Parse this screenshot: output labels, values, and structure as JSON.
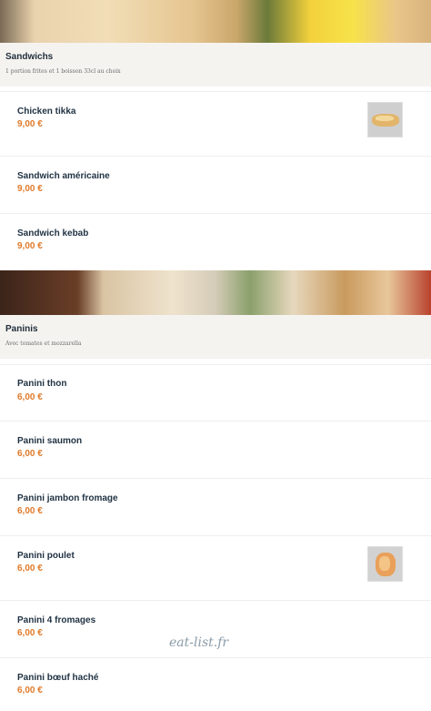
{
  "colors": {
    "accent_price": "#e07a2a",
    "header_bg": "#f5f3f0",
    "title": "#1f3142"
  },
  "categories": [
    {
      "title": "Sandwichs",
      "subtitle": "1 portion frites et 1 boisson 33cl au choix",
      "items": [
        {
          "name": "Chicken tikka",
          "price": "9,00 €",
          "image": "sandwich-photo"
        },
        {
          "name": "Sandwich américaine",
          "price": "9,00 €"
        },
        {
          "name": "Sandwich kebab",
          "price": "9,00 €"
        }
      ]
    },
    {
      "title": "Paninis",
      "subtitle": "Avec tomates et mozzarella",
      "items": [
        {
          "name": "Panini thon",
          "price": "6,00 €"
        },
        {
          "name": "Panini saumon",
          "price": "6,00 €"
        },
        {
          "name": "Panini jambon fromage",
          "price": "6,00 €"
        },
        {
          "name": "Panini poulet",
          "price": "6,00 €",
          "image": "panini-photo"
        },
        {
          "name": "Panini 4 fromages",
          "price": "6,00 €"
        },
        {
          "name": "Panini bœuf haché",
          "price": "6,00 €"
        }
      ]
    }
  ],
  "watermark": "eat-list.fr"
}
